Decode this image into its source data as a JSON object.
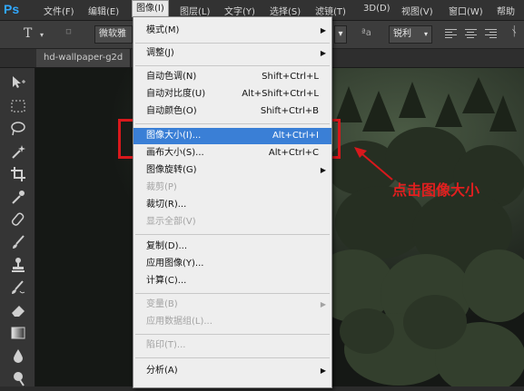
{
  "menubar": {
    "logo": "Ps",
    "items": [
      "文件(F)",
      "编辑(E)",
      "图像(I)",
      "图层(L)",
      "文字(Y)",
      "选择(S)",
      "滤镜(T)",
      "3D(D)",
      "视图(V)",
      "窗口(W)",
      "帮助"
    ]
  },
  "options": {
    "tool_glyph": "T",
    "font_family": "微软雅",
    "aa_glyph": "ªa",
    "aa_mode": "锐利"
  },
  "document": {
    "tab_title": "hd-wallpaper-g2d",
    "collapse_glyph": "»"
  },
  "image_menu": {
    "items": [
      {
        "label": "模式(M)",
        "shortcut": "",
        "submenu": true,
        "disabled": false
      },
      {
        "label": "调整(J)",
        "shortcut": "",
        "submenu": true,
        "disabled": false
      },
      {
        "label": "自动色调(N)",
        "shortcut": "Shift+Ctrl+L",
        "submenu": false,
        "disabled": false
      },
      {
        "label": "自动对比度(U)",
        "shortcut": "Alt+Shift+Ctrl+L",
        "submenu": false,
        "disabled": false
      },
      {
        "label": "自动颜色(O)",
        "shortcut": "Shift+Ctrl+B",
        "submenu": false,
        "disabled": false
      },
      {
        "label": "图像大小(I)...",
        "shortcut": "Alt+Ctrl+I",
        "submenu": false,
        "disabled": false
      },
      {
        "label": "画布大小(S)...",
        "shortcut": "Alt+Ctrl+C",
        "submenu": false,
        "disabled": false
      },
      {
        "label": "图像旋转(G)",
        "shortcut": "",
        "submenu": true,
        "disabled": false
      },
      {
        "label": "裁剪(P)",
        "shortcut": "",
        "submenu": false,
        "disabled": true
      },
      {
        "label": "裁切(R)...",
        "shortcut": "",
        "submenu": false,
        "disabled": false
      },
      {
        "label": "显示全部(V)",
        "shortcut": "",
        "submenu": false,
        "disabled": true
      },
      {
        "label": "复制(D)...",
        "shortcut": "",
        "submenu": false,
        "disabled": false
      },
      {
        "label": "应用图像(Y)...",
        "shortcut": "",
        "submenu": false,
        "disabled": false
      },
      {
        "label": "计算(C)...",
        "shortcut": "",
        "submenu": false,
        "disabled": false
      },
      {
        "label": "变量(B)",
        "shortcut": "",
        "submenu": true,
        "disabled": true
      },
      {
        "label": "应用数据组(L)...",
        "shortcut": "",
        "submenu": false,
        "disabled": true
      },
      {
        "label": "陷印(T)...",
        "shortcut": "",
        "submenu": false,
        "disabled": true
      },
      {
        "label": "分析(A)",
        "shortcut": "",
        "submenu": true,
        "disabled": false
      }
    ]
  },
  "annotation": {
    "text": "点击图像大小"
  },
  "colors": {
    "highlight": "#3a7fd6",
    "annotation_red": "#d8181c",
    "menu_bg": "#eeeeee"
  }
}
